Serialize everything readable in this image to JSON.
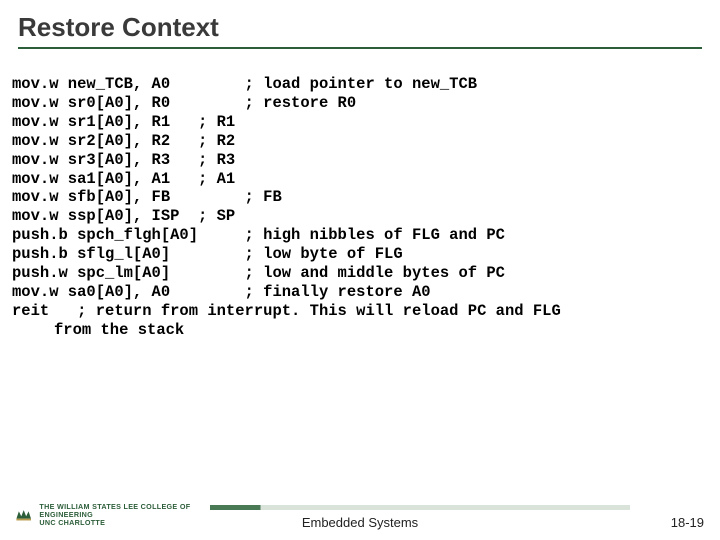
{
  "title": "Restore Context",
  "code_lines": [
    "mov.w new_TCB, A0        ; load pointer to new_TCB",
    "mov.w sr0[A0], R0        ; restore R0",
    "mov.w sr1[A0], R1   ; R1",
    "mov.w sr2[A0], R2   ; R2",
    "mov.w sr3[A0], R3   ; R3",
    "mov.w sa1[A0], A1   ; A1",
    "mov.w sfb[A0], FB        ; FB",
    "mov.w ssp[A0], ISP  ; SP",
    "push.b spch_flgh[A0]     ; high nibbles of FLG and PC",
    "push.b sflg_l[A0]        ; low byte of FLG",
    "push.w spc_lm[A0]        ; low and middle bytes of PC",
    "mov.w sa0[A0], A0        ; finally restore A0",
    "reit   ; return from interrupt. This will reload PC and FLG"
  ],
  "code_tail_indented": "from the stack",
  "footer": {
    "center": "Embedded Systems",
    "page": "18-19",
    "logo_lines": [
      "THE WILLIAM STATES LEE COLLEGE OF ENGINEERING",
      "UNC CHARLOTTE"
    ]
  }
}
